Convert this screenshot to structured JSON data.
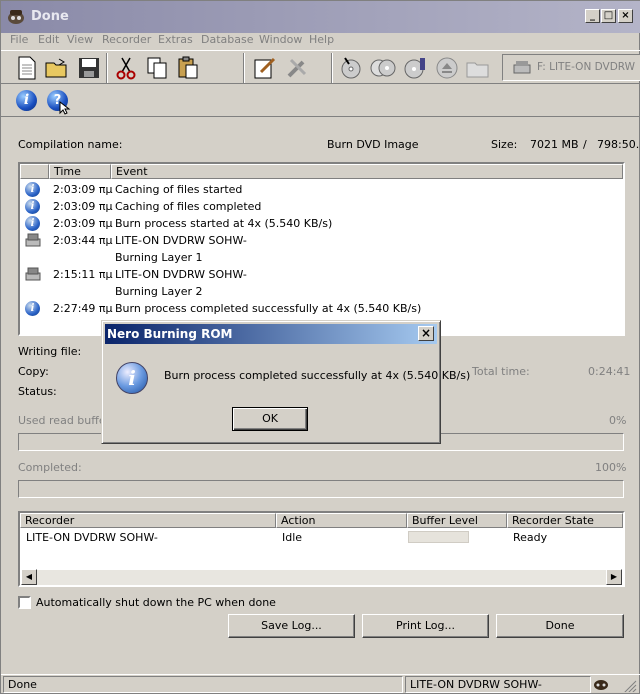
{
  "window": {
    "title": "Done"
  },
  "menu": [
    "File",
    "Edit",
    "View",
    "Recorder",
    "Extras",
    "Database",
    "Window",
    "Help"
  ],
  "toolbar": {
    "drive_label": "F: LITE-ON  DVDRW"
  },
  "compilation": {
    "name_label": "Compilation name:",
    "name_value": "Burn DVD Image",
    "size_label": "Size:",
    "size_value": "7021 MB",
    "size_sep": "/",
    "size_time": "798:50.!"
  },
  "log": {
    "columns": [
      "Time",
      "Event"
    ],
    "rows": [
      {
        "icon": "info",
        "time": "2:03:09 πμ",
        "event": "Caching of files started"
      },
      {
        "icon": "info",
        "time": "2:03:09 πμ",
        "event": "Caching of files completed"
      },
      {
        "icon": "info",
        "time": "2:03:09 πμ",
        "event": "Burn process started at 4x (5.540 KB/s)"
      },
      {
        "icon": "drive",
        "time": "2:03:44 πμ",
        "event": "LITE-ON  DVDRW SOHW-"
      },
      {
        "icon": "",
        "time": "",
        "event": "Burning Layer 1"
      },
      {
        "icon": "drive",
        "time": "2:15:11 πμ",
        "event": "LITE-ON  DVDRW SOHW-"
      },
      {
        "icon": "",
        "time": "",
        "event": "Burning Layer 2"
      },
      {
        "icon": "info",
        "time": "2:27:49 πμ",
        "event": "Burn process completed successfully at 4x (5.540 KB/s)"
      }
    ]
  },
  "status": {
    "writing_file_label": "Writing file:",
    "copy_label": "Copy:",
    "status_label": "Status:",
    "total_time_label": "Total time:",
    "total_time_value": "0:24:41",
    "used_read_buffer_label": "Used read buffer:",
    "used_read_buffer_value": "0%",
    "used_read_buffer_pct": 0,
    "completed_label": "Completed:",
    "completed_value": "100%",
    "completed_pct": 100
  },
  "recorders": {
    "columns": [
      "Recorder",
      "Action",
      "Buffer Level",
      "Recorder State"
    ],
    "rows": [
      {
        "recorder": "LITE-ON DVDRW SOHW-",
        "action": "Idle",
        "buffer": 0,
        "state": "Ready"
      }
    ]
  },
  "auto_shutdown": {
    "label": "Automatically shut down the PC when done",
    "checked": false
  },
  "buttons": {
    "save_log": "Save Log...",
    "print_log": "Print Log...",
    "done": "Done"
  },
  "dialog": {
    "title": "Nero Burning ROM",
    "message": "Burn process completed successfully at 4x (5.540 KB/s)",
    "ok": "OK",
    "close": "×"
  },
  "statusbar": {
    "left": "Done",
    "drive": "LITE-ON  DVDRW SOHW-"
  }
}
